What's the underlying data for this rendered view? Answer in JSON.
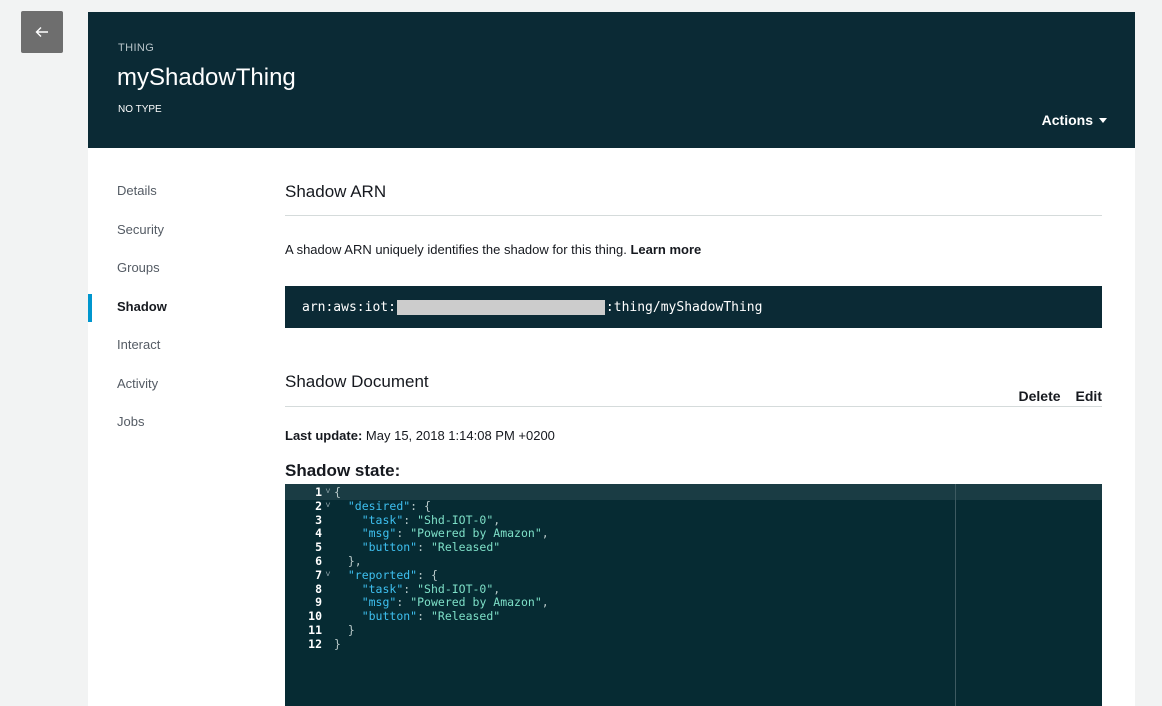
{
  "header": {
    "eyebrow": "THING",
    "title": "myShadowThing",
    "subtitle": "NO TYPE",
    "actions_label": "Actions"
  },
  "sidebar": {
    "items": [
      {
        "label": "Details"
      },
      {
        "label": "Security"
      },
      {
        "label": "Groups"
      },
      {
        "label": "Shadow",
        "active": true
      },
      {
        "label": "Interact"
      },
      {
        "label": "Activity"
      },
      {
        "label": "Jobs"
      }
    ]
  },
  "shadow_arn": {
    "heading": "Shadow ARN",
    "description": "A shadow ARN uniquely identifies the shadow for this thing.",
    "learn_more": "Learn more",
    "arn_prefix": "arn:aws:iot:",
    "arn_suffix": ":thing/myShadowThing"
  },
  "shadow_document": {
    "heading": "Shadow Document",
    "delete_label": "Delete",
    "edit_label": "Edit",
    "last_update_label": "Last update:",
    "last_update_value": "May 15, 2018 1:14:08 PM +0200",
    "state_heading": "Shadow state:"
  },
  "editor": {
    "lines": [
      {
        "n": "1",
        "text": "{"
      },
      {
        "n": "2",
        "text": "  \"desired\": {"
      },
      {
        "n": "3",
        "text": "    \"task\": \"Shd-IOT-0\","
      },
      {
        "n": "4",
        "text": "    \"msg\": \"Powered by Amazon\","
      },
      {
        "n": "5",
        "text": "    \"button\": \"Released\""
      },
      {
        "n": "6",
        "text": "  },"
      },
      {
        "n": "7",
        "text": "  \"reported\": {"
      },
      {
        "n": "8",
        "text": "    \"task\": \"Shd-IOT-0\","
      },
      {
        "n": "9",
        "text": "    \"msg\": \"Powered by Amazon\","
      },
      {
        "n": "10",
        "text": "    \"button\": \"Released\""
      },
      {
        "n": "11",
        "text": "  }"
      },
      {
        "n": "12",
        "text": "}"
      }
    ]
  },
  "colors": {
    "header_bg": "#0b2a35",
    "accent": "#0096ce",
    "editor_bg": "#062b33"
  },
  "icons": {
    "back": "arrow-left-icon",
    "actions": "caret-down-icon"
  }
}
